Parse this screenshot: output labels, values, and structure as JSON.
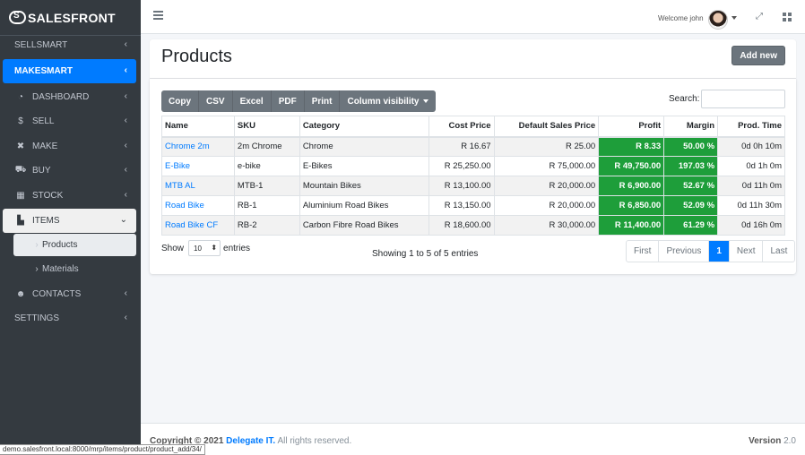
{
  "brand": {
    "name": "SALESFRONT"
  },
  "sidebar": {
    "items": [
      {
        "label": "SELLSMART",
        "icon": "none"
      },
      {
        "label": "MAKESMART",
        "icon": "none"
      },
      {
        "label": "DASHBOARD",
        "icon": "tachometer-icon"
      },
      {
        "label": "SELL",
        "icon": "dollar-icon"
      },
      {
        "label": "MAKE",
        "icon": "tools-icon"
      },
      {
        "label": "BUY",
        "icon": "cart-icon"
      },
      {
        "label": "STOCK",
        "icon": "warehouse-icon"
      },
      {
        "label": "ITEMS",
        "icon": "boxes-icon"
      },
      {
        "label": "Products",
        "icon": "chevron-right-icon"
      },
      {
        "label": "Materials",
        "icon": "chevron-right-icon"
      },
      {
        "label": "CONTACTS",
        "icon": "users-icon"
      },
      {
        "label": "SETTINGS",
        "icon": "none"
      }
    ]
  },
  "topbar": {
    "welcome": "Welcome john"
  },
  "page": {
    "title": "Products",
    "add_button": "Add new"
  },
  "toolbar": {
    "buttons": [
      "Copy",
      "CSV",
      "Excel",
      "PDF",
      "Print",
      "Column visibility"
    ]
  },
  "search": {
    "label": "Search:",
    "value": ""
  },
  "table": {
    "headers": [
      "Name",
      "SKU",
      "Category",
      "Cost Price",
      "Default Sales Price",
      "Profit",
      "Margin",
      "Prod. Time"
    ],
    "rows": [
      [
        "Chrome 2m",
        "2m Chrome",
        "Chrome",
        "R 16.67",
        "R 25.00",
        "R 8.33",
        "50.00 %",
        "0d 0h 10m"
      ],
      [
        "E-Bike",
        "e-bike",
        "E-Bikes",
        "R 25,250.00",
        "R 75,000.00",
        "R 49,750.00",
        "197.03 %",
        "0d 1h 0m"
      ],
      [
        "MTB AL",
        "MTB-1",
        "Mountain Bikes",
        "R 13,100.00",
        "R 20,000.00",
        "R 6,900.00",
        "52.67 %",
        "0d 11h 0m"
      ],
      [
        "Road Bike",
        "RB-1",
        "Aluminium Road Bikes",
        "R 13,150.00",
        "R 20,000.00",
        "R 6,850.00",
        "52.09 %",
        "0d 11h 30m"
      ],
      [
        "Road Bike CF",
        "RB-2",
        "Carbon Fibre Road Bikes",
        "R 18,600.00",
        "R 30,000.00",
        "R 11,400.00",
        "61.29 %",
        "0d 16h 0m"
      ]
    ],
    "highlight_color": "#1e9e3a"
  },
  "length": {
    "show": "Show",
    "value": "10",
    "entries": "entries"
  },
  "info": "Showing 1 to 5 of 5 entries",
  "pagination": {
    "first": "First",
    "previous": "Previous",
    "current": "1",
    "next": "Next",
    "last": "Last"
  },
  "footer": {
    "copyright": "Copyright © 2021",
    "company": "Delegate IT.",
    "rights": "All rights reserved.",
    "version_label": "Version",
    "version": "2.0"
  },
  "statusbar": {
    "url": "demo.salesfront.local:8000/mrp/items/product/product_add/34/"
  },
  "colors": {
    "sidebar_bg": "#343a40",
    "active": "#007bff",
    "secondary": "#6c757d"
  }
}
